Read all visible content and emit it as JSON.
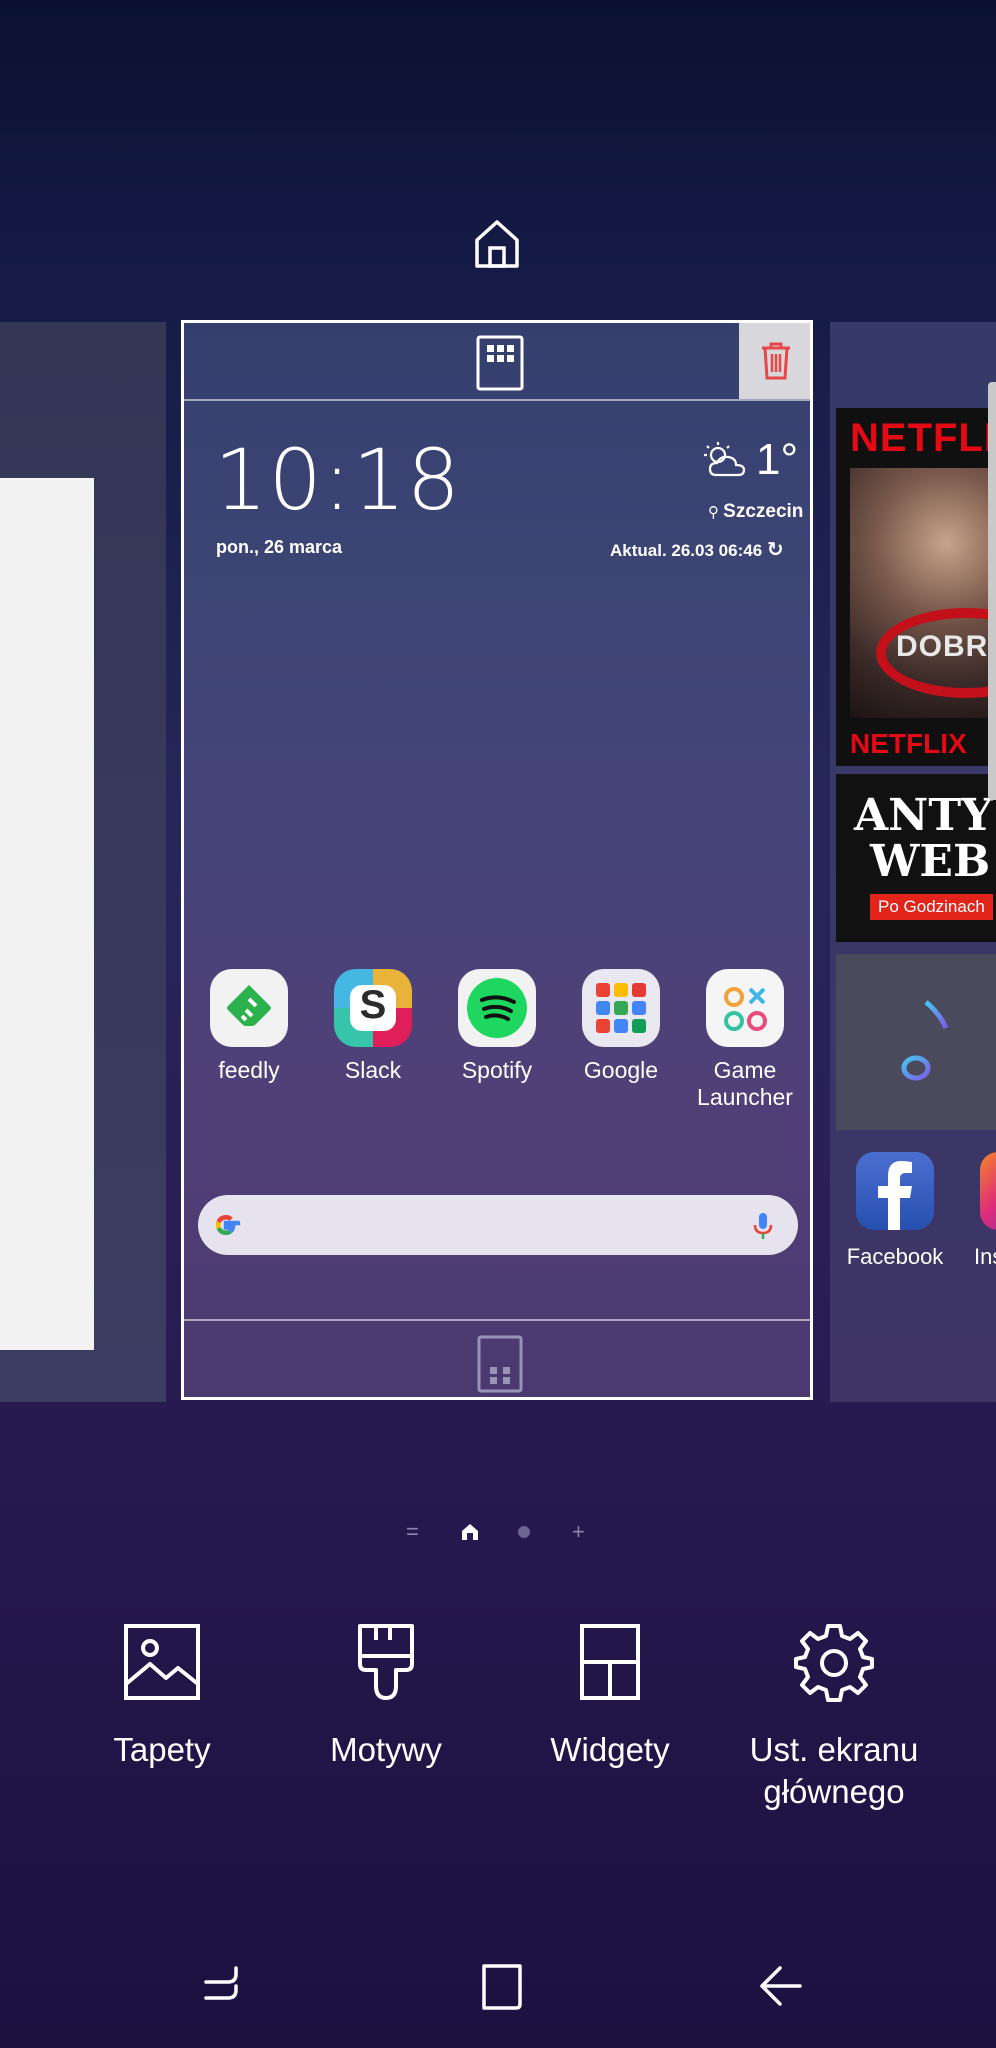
{
  "home_screen_preview": {
    "clock_widget": {
      "time": "10:18",
      "date": "pon., 26 marca",
      "temperature": "1°",
      "location": "Szczecin",
      "updated": "Aktual. 26.03 06:46"
    },
    "apps": [
      {
        "label": "feedly",
        "icon": "feedly-icon"
      },
      {
        "label": "Slack",
        "icon": "slack-icon"
      },
      {
        "label": "Spotify",
        "icon": "spotify-icon"
      },
      {
        "label": "Google",
        "icon": "google-folder-icon"
      },
      {
        "label": "Game Launcher",
        "icon": "game-launcher-icon"
      }
    ]
  },
  "right_page": {
    "netflix_widget": {
      "logo_top": "NETFLIX",
      "caption": "DOBRZ",
      "logo_bottom": "NETFLIX"
    },
    "antyweb_widget": {
      "line1": "ANTY",
      "line2": "WEB",
      "badge": "Po Godzinach"
    },
    "apps": [
      {
        "label": "Facebook",
        "icon": "facebook-icon"
      },
      {
        "label": "Ins",
        "icon": "instagram-icon"
      }
    ]
  },
  "page_indicators": [
    "=",
    "home",
    "dot",
    "+"
  ],
  "actions": [
    {
      "label": "Tapety",
      "icon": "wallpaper-icon"
    },
    {
      "label": "Motywy",
      "icon": "themes-brush-icon"
    },
    {
      "label": "Widgety",
      "icon": "widgets-icon"
    },
    {
      "label": "Ust. ekranu głównego",
      "label_line1": "Ust. ekranu",
      "label_line2": "głównego",
      "icon": "settings-gear-icon"
    }
  ],
  "colors": {
    "accent_red": "#e54646",
    "netflix_red": "#e50914",
    "spotify_green": "#1ed760",
    "feedly_green": "#2bb24c"
  }
}
